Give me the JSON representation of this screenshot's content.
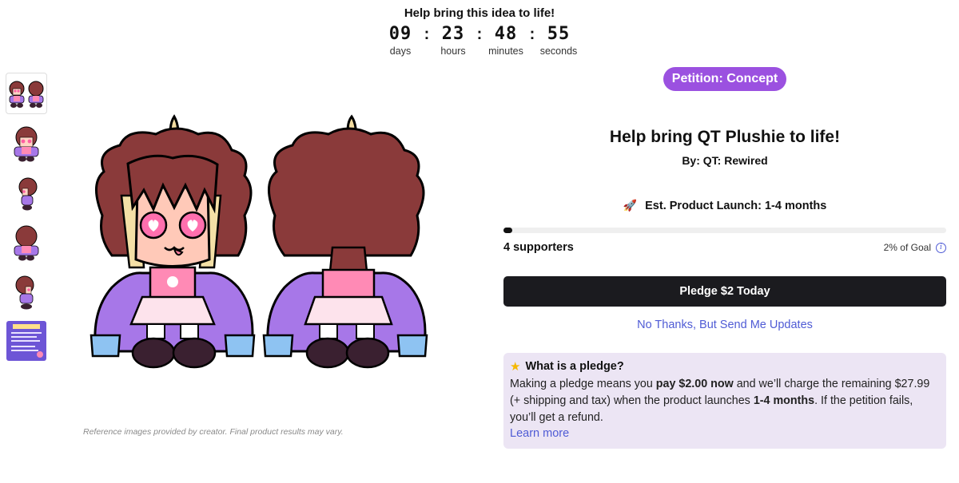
{
  "header": {
    "title": "Help bring this idea to life!",
    "countdown": [
      {
        "value": "09",
        "label": "days"
      },
      {
        "value": "23",
        "label": "hours"
      },
      {
        "value": "48",
        "label": "minutes"
      },
      {
        "value": "55",
        "label": "seconds"
      }
    ],
    "separator": ":"
  },
  "gallery": {
    "thumbnails": [
      "front-and-back",
      "front",
      "side",
      "back",
      "side-alt",
      "info-card"
    ],
    "disclaimer": "Reference images provided by creator. Final product results may vary."
  },
  "panel": {
    "badge": "Petition: Concept",
    "title": "Help bring QT Plushie to life!",
    "creator": "By: QT: Rewired",
    "launch": "Est. Product Launch: 1-4 months",
    "progress_fraction": 0.02,
    "supporters": "4 supporters",
    "goal": "2% of Goal",
    "pledge_button": "Pledge $2 Today",
    "updates_link": "No Thanks, But Send Me Updates",
    "pledge_info": {
      "title": "What is a pledge?",
      "body_1": "Making a pledge means you ",
      "body_bold_1": "pay $2.00 now",
      "body_2": " and we’ll charge the remaining $27.99 (+ shipping and tax) when the product launches ",
      "body_bold_2": "1-4 months",
      "body_3": ". If the petition fails, you’ll get a refund.",
      "learn_more": "Learn more"
    }
  },
  "colors": {
    "badge": "#9b51e0",
    "button": "#1b1b1f",
    "link": "#4f5bd5",
    "info_bg": "#ece5f4"
  }
}
